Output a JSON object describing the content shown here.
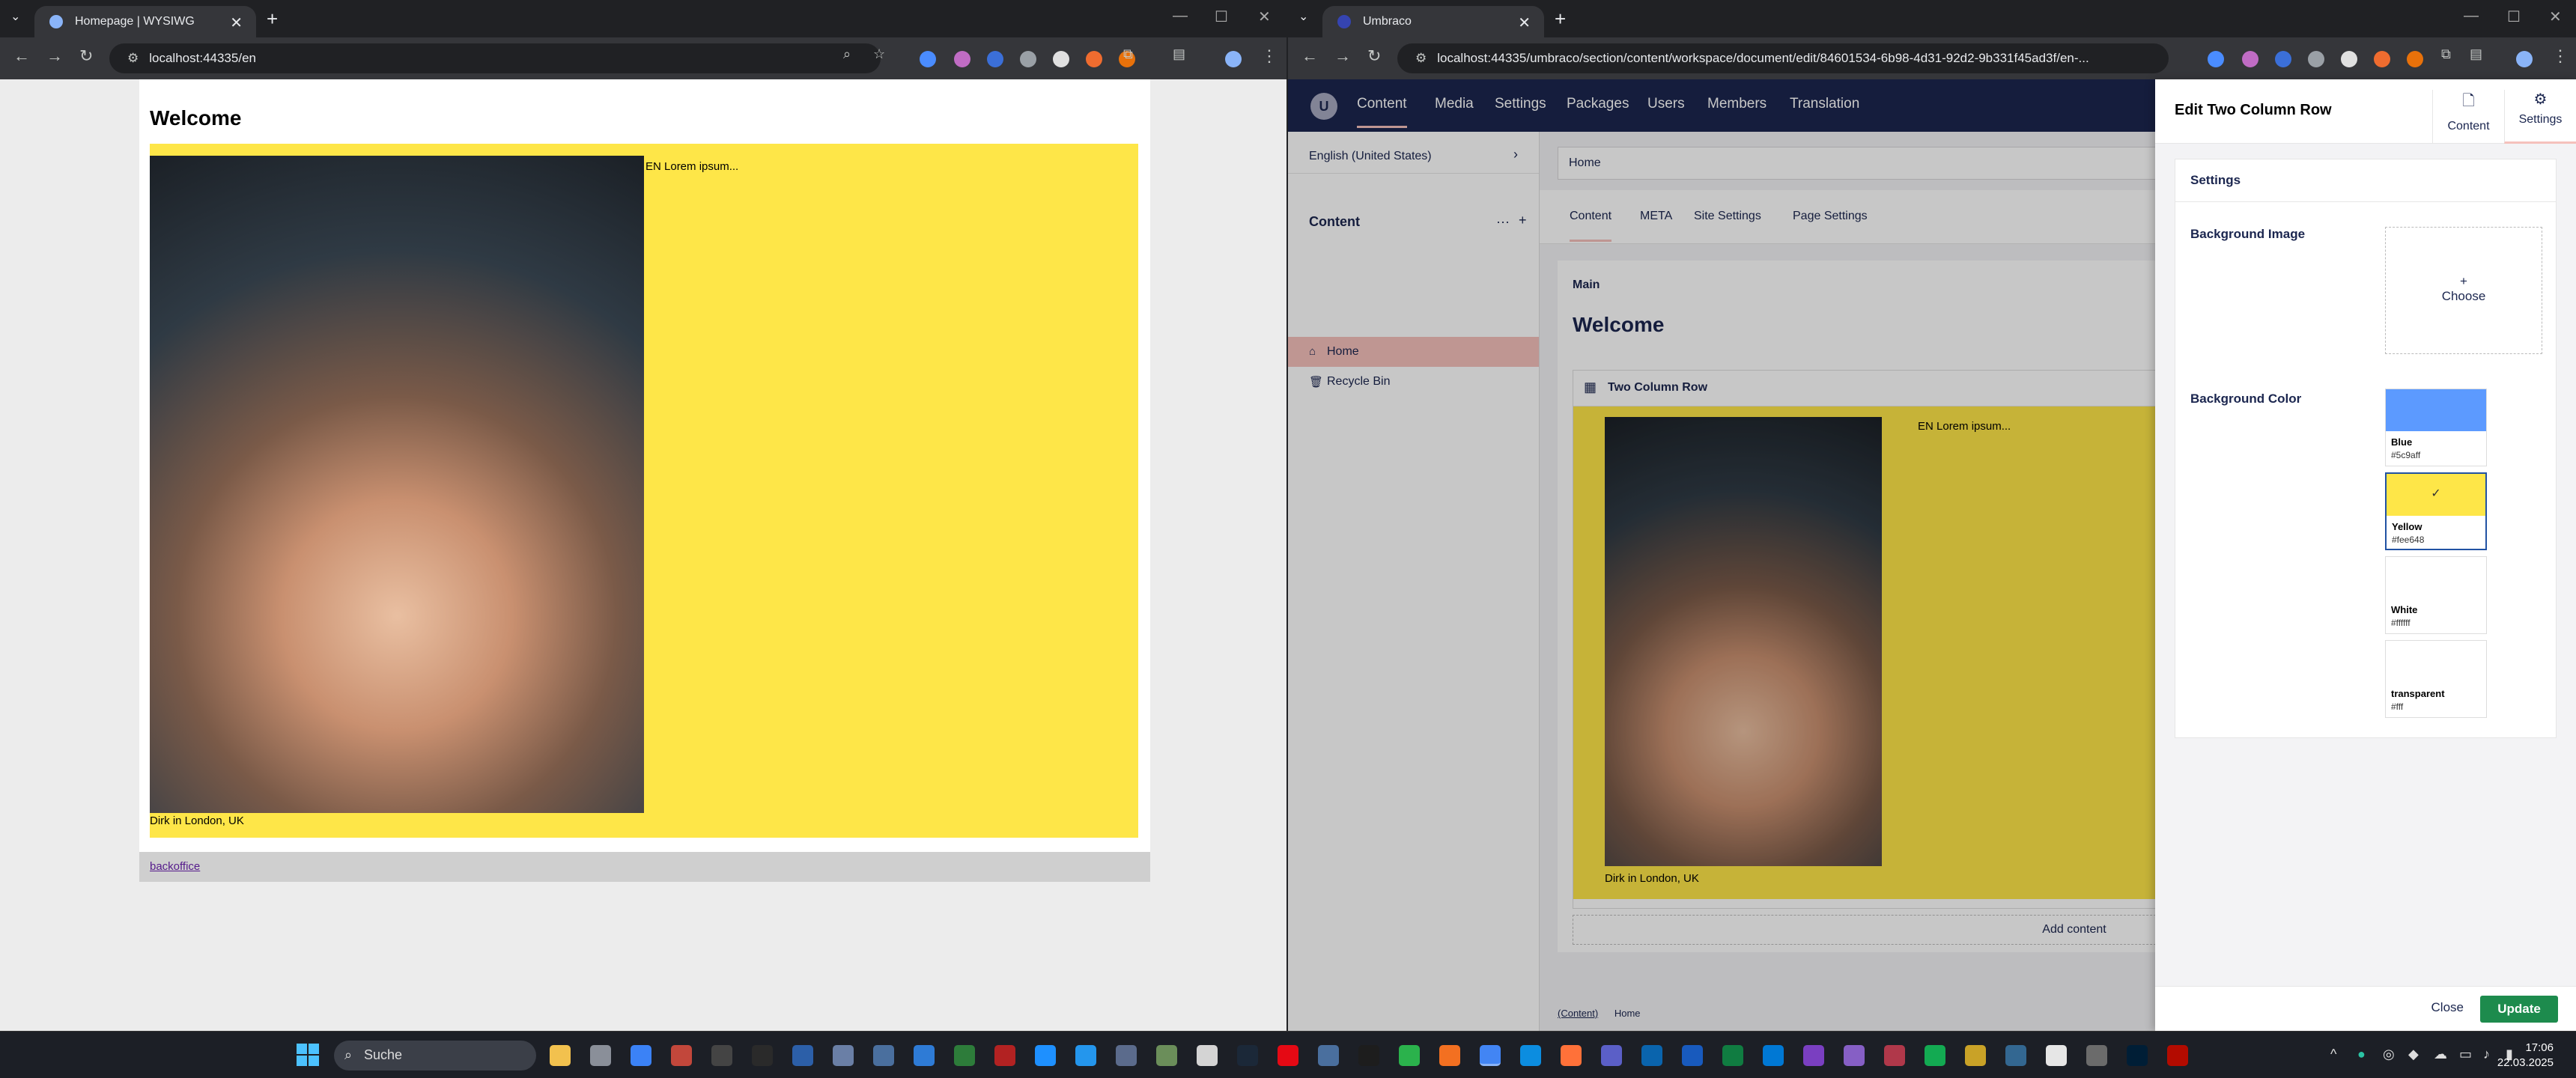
{
  "left_window": {
    "tab_title": "Homepage | WYSIWG",
    "url": "localhost:44335/en",
    "page": {
      "heading": "Welcome",
      "lorem": "EN Lorem ipsum...",
      "caption": "Dirk in London, UK",
      "row_color": "#fee648",
      "footer_link": "backoffice"
    }
  },
  "right_window": {
    "tab_title": "Umbraco",
    "url": "localhost:44335/umbraco/section/content/workspace/document/edit/84601534-6b98-4d31-92d2-9b331f45ad3f/en-...",
    "top_nav": [
      "Content",
      "Media",
      "Settings",
      "Packages",
      "Users",
      "Members",
      "Translation"
    ],
    "language": "English (United States)",
    "tree": {
      "header": "Content",
      "actions": "···",
      "add": "+",
      "items": [
        "Home",
        "Recycle Bin"
      ]
    },
    "doc_name": "Home",
    "content_tabs": [
      "Content",
      "META",
      "Site Settings",
      "Page Settings"
    ],
    "group": "Main",
    "welcome": "Welcome",
    "block_title": "Two Column Row",
    "block_lorem": "EN Lorem ipsum...",
    "block_caption": "Dirk in London, UK",
    "add_content": "Add content",
    "breadcrumb": [
      "(Content)",
      "Home"
    ],
    "panel": {
      "title": "Edit Two Column Row",
      "apps": [
        "Content",
        "Settings"
      ],
      "section": "Settings",
      "bg_image_label": "Background Image",
      "choose": "Choose",
      "bg_color_label": "Background Color",
      "swatches": [
        {
          "name": "Blue",
          "hex": "#5c9aff"
        },
        {
          "name": "Yellow",
          "hex": "#fee648"
        },
        {
          "name": "White",
          "hex": "#ffffff"
        },
        {
          "name": "transparent",
          "hex": "#fff"
        }
      ],
      "selected_swatch": "Yellow",
      "close": "Close",
      "update": "Update"
    }
  },
  "taskbar": {
    "search": "Suche",
    "time": "17:06",
    "date": "22.03.2025"
  }
}
